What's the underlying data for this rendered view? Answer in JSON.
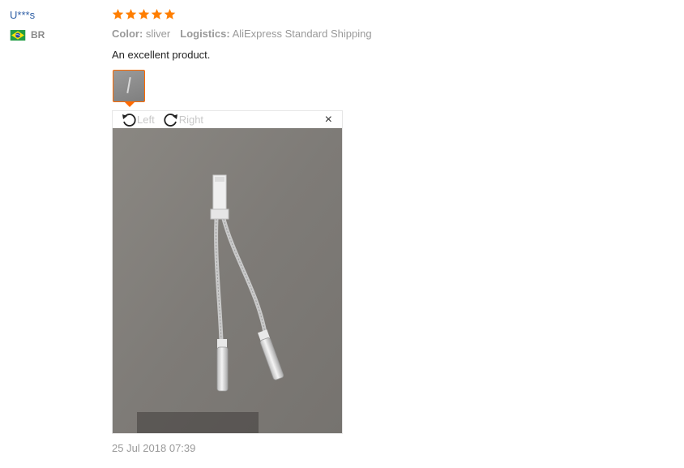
{
  "reviewer": {
    "name": "U***s",
    "country_code": "BR",
    "flag_icon": "brazil-flag-icon"
  },
  "review": {
    "rating_stars": 5,
    "color_label": "Color:",
    "color_value": "sliver",
    "logistics_label": "Logistics:",
    "logistics_value": "AliExpress Standard Shipping",
    "text": "An excellent product.",
    "date": "25 Jul 2018 07:39"
  },
  "viewer": {
    "rotate_left_label": "Left",
    "rotate_right_label": "Right",
    "close_symbol": "×"
  },
  "colors": {
    "star": "#ff7e00",
    "accent_border": "#ff6a00",
    "user_link": "#2f5fa5"
  }
}
